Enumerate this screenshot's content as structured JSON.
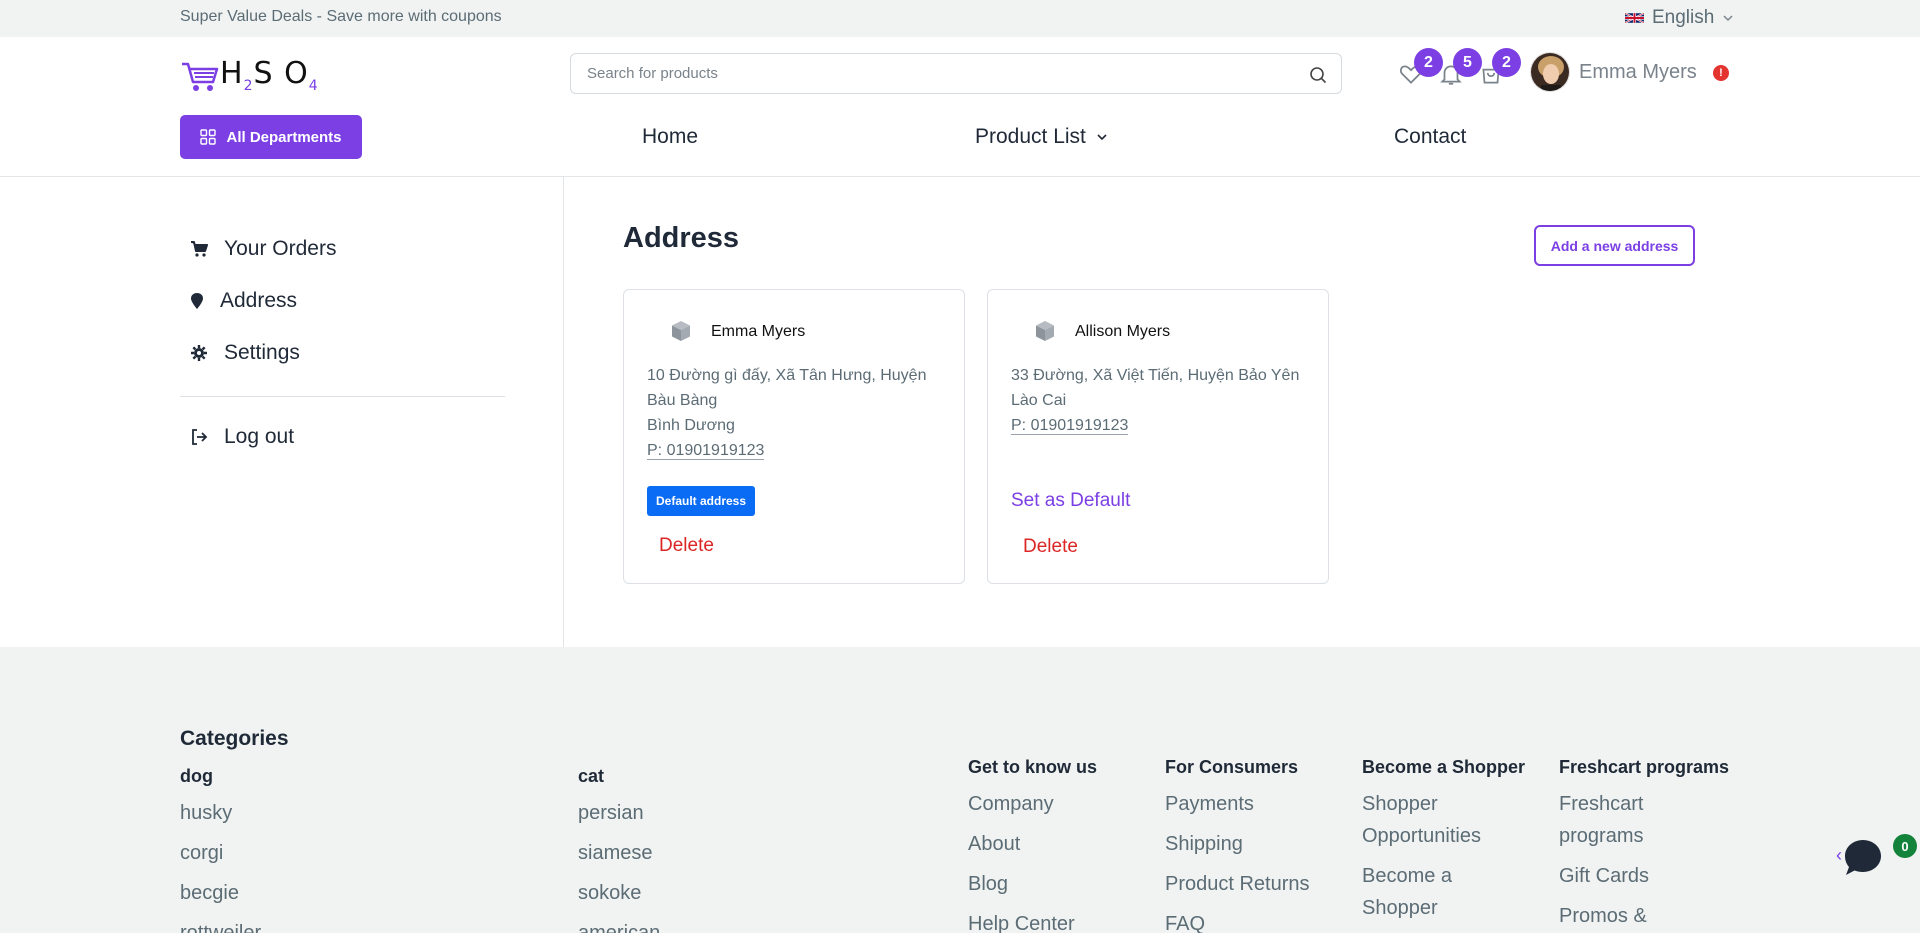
{
  "topbar": {
    "promo": "Super Value Deals - Save more with coupons",
    "language": "English"
  },
  "header": {
    "logo": {
      "h": "H",
      "two": "2",
      "s": "S",
      "o": "O",
      "four": "4"
    },
    "search_placeholder": "Search for products",
    "wishlist_count": "2",
    "notifications_count": "5",
    "cart_count": "2",
    "username": "Emma Myers",
    "alert": "!",
    "all_departments": "All Departments",
    "nav": {
      "home": "Home",
      "product_list": "Product List",
      "contact": "Contact"
    }
  },
  "sidebar": {
    "orders": "Your Orders",
    "address": "Address",
    "settings": "Settings",
    "logout": "Log out"
  },
  "main": {
    "title": "Address",
    "add_button": "Add a new address",
    "addresses": [
      {
        "name": "Emma Myers",
        "line1": "10 Đường gì đấy, Xã Tân Hưng, Huyện Bàu Bàng",
        "line2": "Bình Dương",
        "phone": "P: 01901919123",
        "default_label": "Default address",
        "delete_label": "Delete"
      },
      {
        "name": "Allison Myers",
        "line1": "33 Đường, Xã Việt Tiến, Huyện Bảo Yên",
        "line2": "Lào Cai",
        "phone": "P: 01901919123",
        "set_default_label": "Set as Default",
        "delete_label": "Delete"
      }
    ]
  },
  "footer": {
    "categories_title": "Categories",
    "dog": {
      "title": "dog",
      "items": [
        "husky",
        "corgi",
        "becgie",
        "rottweiler"
      ]
    },
    "cat": {
      "title": "cat",
      "items": [
        "persian",
        "siamese",
        "sokoke",
        "american"
      ]
    },
    "get_to_know": {
      "title": "Get to know us",
      "items": [
        "Company",
        "About",
        "Blog",
        "Help Center"
      ]
    },
    "consumers": {
      "title": "For Consumers",
      "items": [
        "Payments",
        "Shipping",
        "Product Returns",
        "FAQ"
      ]
    },
    "shopper": {
      "title": "Become a Shopper",
      "items": [
        "Shopper Opportunities",
        "Become a Shopper"
      ]
    },
    "programs": {
      "title": "Freshcart programs",
      "items": [
        "Freshcart programs",
        "Gift Cards",
        "Promos &"
      ]
    },
    "chat_count": "0"
  },
  "colors": {
    "accent": "#7b3fe4",
    "danger": "#dc2626",
    "info": "#0a6cf5"
  }
}
